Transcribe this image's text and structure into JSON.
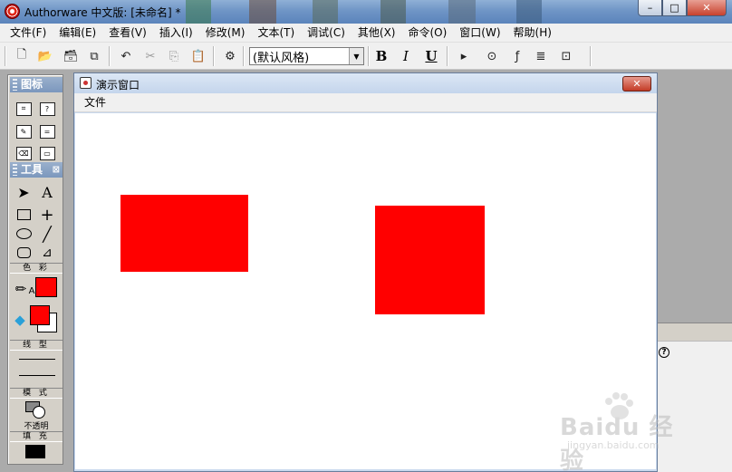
{
  "window": {
    "title": "Authorware 中文版: [未命名] *",
    "min": "–",
    "max": "□",
    "close": "✕"
  },
  "menus": [
    "文件(F)",
    "编辑(E)",
    "查看(V)",
    "插入(I)",
    "修改(M)",
    "文本(T)",
    "调试(C)",
    "其他(X)",
    "命令(O)",
    "窗口(W)",
    "帮助(H)"
  ],
  "toolbar": {
    "style_value": "(默认风格)",
    "bold": "B",
    "italic": "I",
    "underline": "U"
  },
  "toolbox": {
    "icons_title": "图标",
    "tools_title": "工具",
    "color_label": "色 彩",
    "line_label": "线 型",
    "mode_label": "模 式",
    "mode_value": "不透明",
    "fill_label": "填 充",
    "text_tool": "A",
    "pen_label": "A"
  },
  "colors": {
    "stroke_color": "#ff0000",
    "fill_fore": "#ff0000",
    "fill_back": "#ffffff",
    "fill_pattern": "#000000"
  },
  "presentation": {
    "title": "演示窗口",
    "menu_file": "文件",
    "close": "✕",
    "shapes": [
      {
        "kind": "rectangle",
        "color": "#ff0000"
      },
      {
        "kind": "rectangle",
        "color": "#ff0000"
      }
    ]
  },
  "watermark": {
    "word": "Baidu 经验",
    "sub": "jingyan.baidu.com"
  }
}
